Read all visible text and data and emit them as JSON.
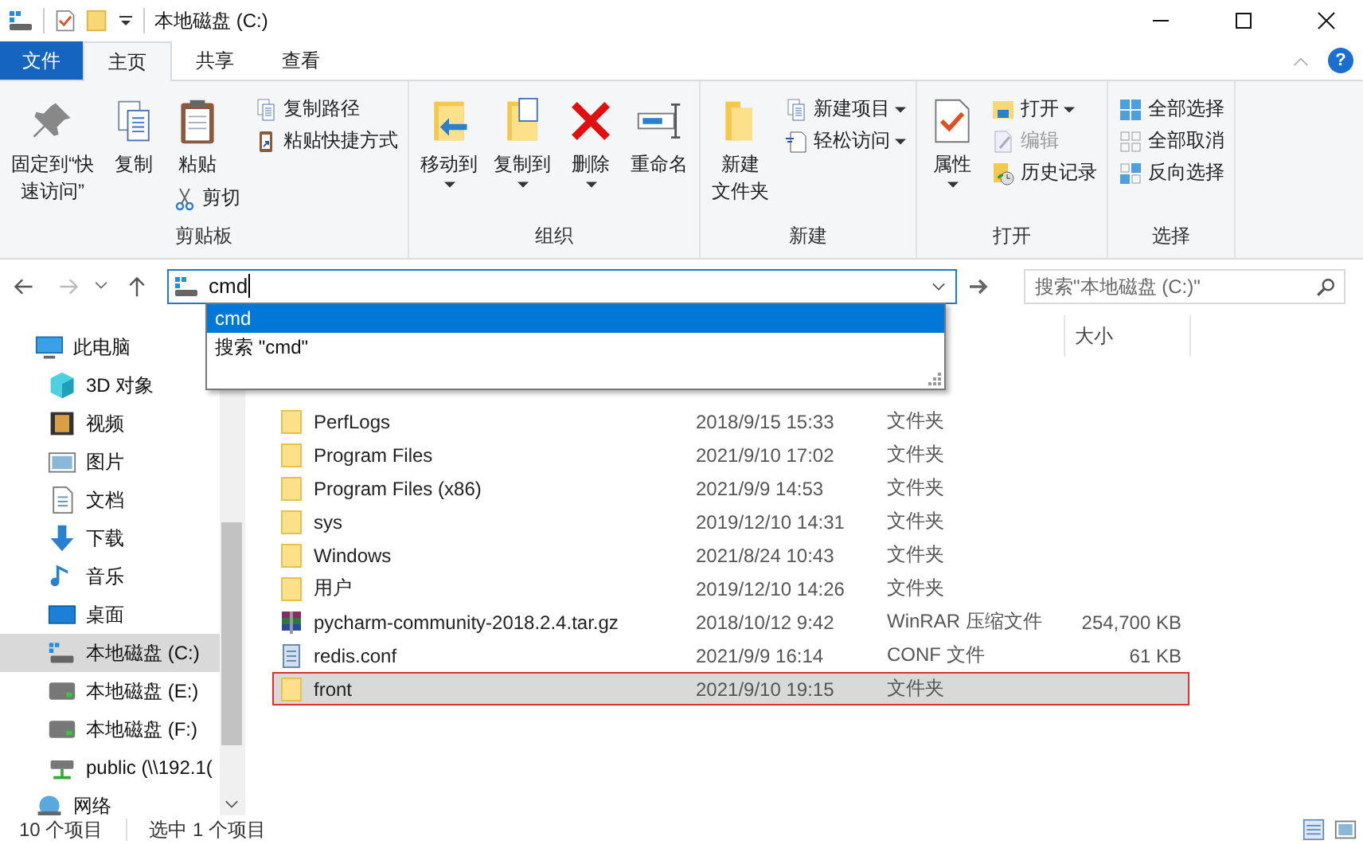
{
  "window": {
    "title": "本地磁盘 (C:)"
  },
  "tabs": [
    {
      "label": "文件",
      "kind": "file",
      "selected": false
    },
    {
      "label": "主页",
      "kind": "tab",
      "selected": true
    },
    {
      "label": "共享",
      "kind": "tab",
      "selected": false
    },
    {
      "label": "查看",
      "kind": "tab",
      "selected": false
    }
  ],
  "help": "?",
  "ribbon": [
    {
      "label": "剪贴板",
      "columns": [
        {
          "large": [
            {
              "lines": [
                "固定到“快",
                "速访问”"
              ],
              "kind": "pin",
              "caret": false
            }
          ]
        },
        {
          "large": [
            {
              "lines": [
                "复制"
              ],
              "kind": "copy",
              "caret": false
            }
          ]
        },
        {
          "large": [
            {
              "lines": [
                "粘贴"
              ],
              "kind": "paste",
              "caret": false
            }
          ],
          "small": [
            {
              "label": "剪切",
              "kind": "cut",
              "caret": false,
              "disabled": false
            }
          ]
        },
        {
          "small": [
            {
              "label": "复制路径",
              "kind": "path",
              "caret": false,
              "disabled": false
            },
            {
              "label": "粘贴快捷方式",
              "kind": "shortcut",
              "caret": false,
              "disabled": false
            }
          ]
        }
      ]
    },
    {
      "label": "组织",
      "columns": [
        {
          "large": [
            {
              "lines": [
                "移动到"
              ],
              "kind": "move",
              "caret": true
            }
          ]
        },
        {
          "large": [
            {
              "lines": [
                "复制到"
              ],
              "kind": "copyto",
              "caret": true
            }
          ]
        },
        {
          "large": [
            {
              "lines": [
                "删除"
              ],
              "kind": "delete",
              "caret": true
            }
          ]
        },
        {
          "large": [
            {
              "lines": [
                "重命名"
              ],
              "kind": "rename",
              "caret": false
            }
          ]
        }
      ]
    },
    {
      "label": "新建",
      "columns": [
        {
          "large": [
            {
              "lines": [
                "新建",
                "文件夹"
              ],
              "kind": "folder",
              "caret": false
            }
          ]
        },
        {
          "small": [
            {
              "label": "新建项目",
              "kind": "newitem",
              "caret": true,
              "disabled": false
            },
            {
              "label": "轻松访问",
              "kind": "easy",
              "caret": true,
              "disabled": false
            }
          ]
        }
      ]
    },
    {
      "label": "打开",
      "columns": [
        {
          "large": [
            {
              "lines": [
                "属性"
              ],
              "kind": "props",
              "caret": true
            }
          ]
        },
        {
          "small": [
            {
              "label": "打开",
              "kind": "open",
              "caret": true,
              "disabled": false
            },
            {
              "label": "编辑",
              "kind": "edit",
              "caret": false,
              "disabled": true
            },
            {
              "label": "历史记录",
              "kind": "history",
              "caret": false,
              "disabled": false
            }
          ]
        }
      ]
    },
    {
      "label": "选择",
      "columns": [
        {
          "small": [
            {
              "label": "全部选择",
              "kind": "selall",
              "caret": false,
              "disabled": false
            },
            {
              "label": "全部取消",
              "kind": "selnone",
              "caret": false,
              "disabled": false
            },
            {
              "label": "反向选择",
              "kind": "selinv",
              "caret": false,
              "disabled": false
            }
          ]
        }
      ]
    }
  ],
  "address": {
    "value": "cmd"
  },
  "search": {
    "placeholder": "搜索\"本地磁盘 (C:)\""
  },
  "suggestions": [
    {
      "label": "cmd",
      "selected": true
    },
    {
      "label": "搜索 \"cmd\"",
      "selected": false
    }
  ],
  "sidebar": {
    "items": [
      {
        "label": "此电脑",
        "kind": "pc",
        "selected": false,
        "children": [
          {
            "label": "3D 对象",
            "kind": "cube",
            "selected": false
          },
          {
            "label": "视频",
            "kind": "video",
            "selected": false
          },
          {
            "label": "图片",
            "kind": "picture",
            "selected": false
          },
          {
            "label": "文档",
            "kind": "doc",
            "selected": false
          },
          {
            "label": "下载",
            "kind": "download",
            "selected": false
          },
          {
            "label": "音乐",
            "kind": "music",
            "selected": false
          },
          {
            "label": "桌面",
            "kind": "desktop",
            "selected": false
          },
          {
            "label": "本地磁盘 (C:)",
            "kind": "sysdrive",
            "selected": true
          },
          {
            "label": "本地磁盘 (E:)",
            "kind": "drive",
            "selected": false
          },
          {
            "label": "本地磁盘 (F:)",
            "kind": "drive",
            "selected": false
          },
          {
            "label": "public (\\\\192.1(",
            "kind": "netdrive",
            "selected": false
          }
        ]
      },
      {
        "label": "网络",
        "kind": "network",
        "selected": false
      }
    ]
  },
  "table": {
    "columns": [
      {
        "label": "大小"
      }
    ],
    "rows": [
      {
        "name": "PerfLogs",
        "date": "2018/9/15 15:33",
        "type": "文件夹",
        "kind": "folder",
        "selected": false
      },
      {
        "name": "Program Files",
        "date": "2021/9/10 17:02",
        "type": "文件夹",
        "kind": "folder",
        "selected": false
      },
      {
        "name": "Program Files (x86)",
        "date": "2021/9/9 14:53",
        "type": "文件夹",
        "kind": "folder",
        "selected": false
      },
      {
        "name": "sys",
        "date": "2019/12/10 14:31",
        "type": "文件夹",
        "kind": "folder",
        "selected": false
      },
      {
        "name": "Windows",
        "date": "2021/8/24 10:43",
        "type": "文件夹",
        "kind": "folder",
        "selected": false
      },
      {
        "name": "用户",
        "date": "2019/12/10 14:26",
        "type": "文件夹",
        "kind": "folder",
        "selected": false
      },
      {
        "name": "pycharm-community-2018.2.4.tar.gz",
        "date": "2018/10/12 9:42",
        "type": "WinRAR 压缩文件",
        "size": "254,700 KB",
        "kind": "archive",
        "selected": false
      },
      {
        "name": "redis.conf",
        "date": "2021/9/9 16:14",
        "type": "CONF 文件",
        "size": "61 KB",
        "kind": "text",
        "selected": false
      },
      {
        "name": "front",
        "date": "2021/9/10 19:15",
        "type": "文件夹",
        "kind": "folder",
        "selected": true
      }
    ]
  },
  "status_bar": {
    "count": "10 个项目",
    "selection": "选中 1 个项目"
  }
}
